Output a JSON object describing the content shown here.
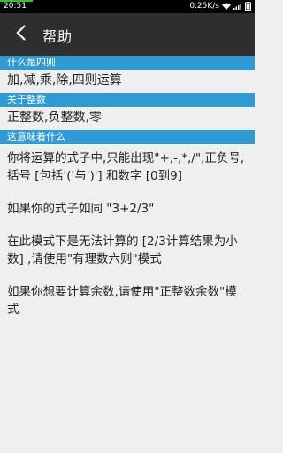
{
  "status": {
    "time": "20:51",
    "network": "0.25K/s",
    "progress": 0.13
  },
  "appbar": {
    "back_icon": "chevron-left-icon",
    "title": "帮助"
  },
  "sections": [
    {
      "header": "什么是四则",
      "body": "加,减,乘,除,四则运算"
    },
    {
      "header": "关于整数",
      "body": "正整数,负整数,零"
    },
    {
      "header": "这意味着什么",
      "paragraphs": [
        "你将运算的式子中,只能出现\"+,-,*,/\",正负号,括号 [包括'('与')'] 和数字 [0到9]",
        "如果你的式子如同 \"3+2/3\"",
        "在此模式下是无法计算的 [2/3计算结果为小数] ,请使用\"有理数六则\"模式",
        "如果你想要计算余数,请使用\"正整数余数\"模式"
      ]
    }
  ],
  "colors": {
    "accent": "#2f9ad4",
    "appbar": "#2e2e2e",
    "background": "#efefef"
  }
}
